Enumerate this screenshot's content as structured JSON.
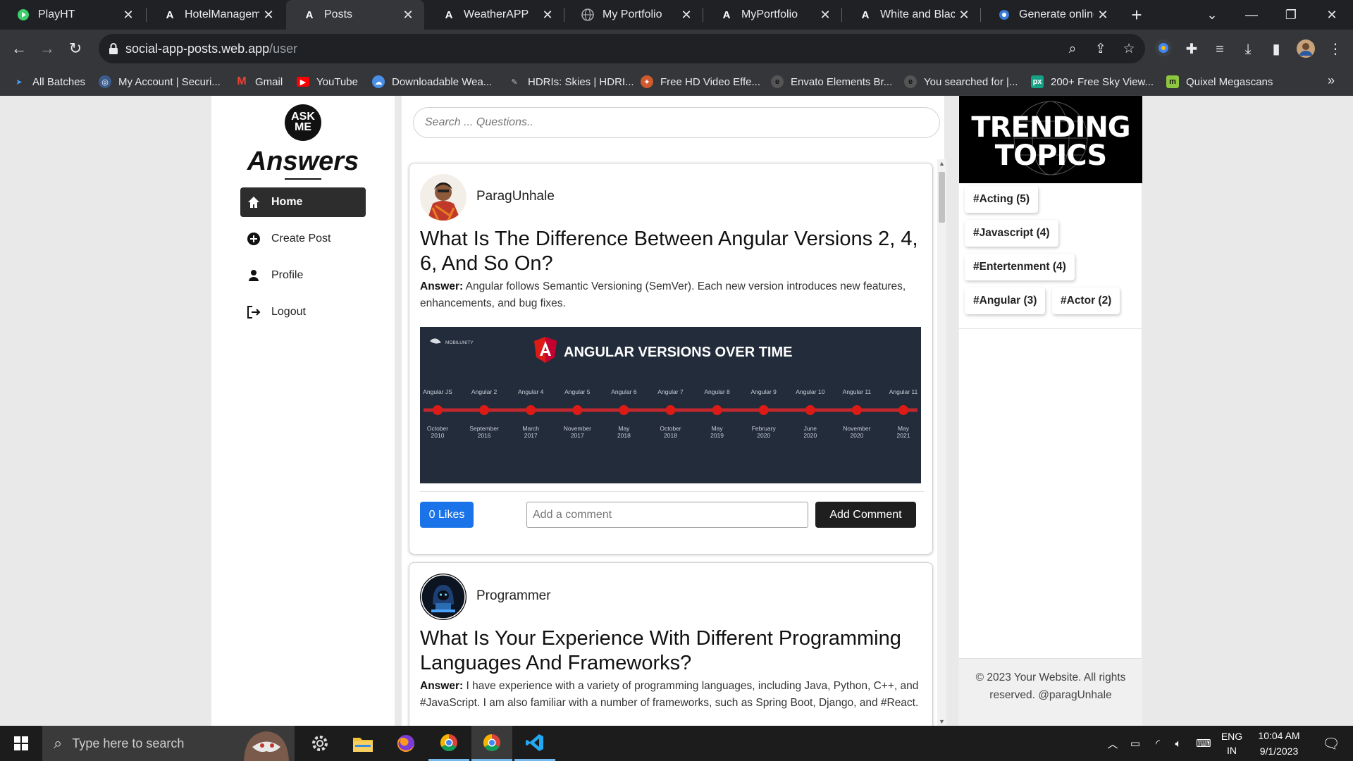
{
  "browser": {
    "tabs": [
      {
        "title": "PlayHT",
        "icon": "playht-icon"
      },
      {
        "title": "HotelManagemen",
        "icon": "angular-icon"
      },
      {
        "title": "Posts",
        "icon": "angular-icon",
        "active": true
      },
      {
        "title": "WeatherAPP",
        "icon": "angular-icon"
      },
      {
        "title": "My Portfolio",
        "icon": "globe-icon"
      },
      {
        "title": "MyPortfolio",
        "icon": "angular-icon"
      },
      {
        "title": "White and Black I",
        "icon": "angular-icon"
      },
      {
        "title": "Generate online A",
        "icon": "gear-icon"
      }
    ],
    "url_host": "social-app-posts.web.app",
    "url_path": "/user",
    "bookmarks": [
      {
        "label": "All Batches",
        "icon": "pin-icon"
      },
      {
        "label": "My Account | Securi...",
        "icon": "shield-icon"
      },
      {
        "label": "Gmail",
        "icon": "gmail-icon"
      },
      {
        "label": "YouTube",
        "icon": "youtube-icon"
      },
      {
        "label": "Downloadable Wea...",
        "icon": "globe-icon"
      },
      {
        "label": "HDRIs: Skies | HDRI...",
        "icon": "hdri-icon"
      },
      {
        "label": "Free HD Video Effe...",
        "icon": "video-icon"
      },
      {
        "label": "Envato Elements Br...",
        "icon": "envato-icon"
      },
      {
        "label": "You searched for |...",
        "icon": "envato-icon"
      },
      {
        "label": "200+ Free Sky View...",
        "icon": "px-icon"
      },
      {
        "label": "Quixel Megascans",
        "icon": "quixel-icon"
      }
    ],
    "bookmarks_more": "»"
  },
  "sidebar": {
    "logo_text": "ASK ME",
    "brand": "Answers",
    "items": [
      {
        "label": "Home",
        "icon": "home-icon",
        "active": true
      },
      {
        "label": "Create Post",
        "icon": "plus-circle-icon"
      },
      {
        "label": "Profile",
        "icon": "person-icon"
      },
      {
        "label": "Logout",
        "icon": "logout-icon"
      }
    ]
  },
  "search": {
    "placeholder": "Search ... Questions.."
  },
  "posts": [
    {
      "author": "ParagUnhale",
      "title": "What Is The Difference Between Angular Versions 2, 4, 6, And So On?",
      "answer_label": "Answer:",
      "answer": " Angular follows Semantic Versioning (SemVer). Each new version introduces new features, enhancements, and bug fixes.",
      "image": {
        "brand": "MOBILUNITY",
        "heading": "ANGULAR VERSIONS OVER TIME",
        "timeline": [
          {
            "version": "Angular JS",
            "date1": "October",
            "date2": "2010"
          },
          {
            "version": "Angular 2",
            "date1": "September",
            "date2": "2016"
          },
          {
            "version": "Angular 4",
            "date1": "March",
            "date2": "2017"
          },
          {
            "version": "Angular 5",
            "date1": "November",
            "date2": "2017"
          },
          {
            "version": "Angular 6",
            "date1": "May",
            "date2": "2018"
          },
          {
            "version": "Angular 7",
            "date1": "October",
            "date2": "2018"
          },
          {
            "version": "Angular 8",
            "date1": "May",
            "date2": "2019"
          },
          {
            "version": "Angular 9",
            "date1": "February",
            "date2": "2020"
          },
          {
            "version": "Angular 10",
            "date1": "June",
            "date2": "2020"
          },
          {
            "version": "Angular 11",
            "date1": "November",
            "date2": "2020"
          },
          {
            "version": "Angular 11",
            "date1": "May",
            "date2": "2021"
          }
        ]
      },
      "likes_label": "0 Likes",
      "comment_placeholder": "Add a comment",
      "comment_button": "Add Comment"
    },
    {
      "author": "Programmer",
      "title": "What Is Your Experience With Different Programming Languages And Frameworks?",
      "answer_label": "Answer:",
      "answer": " I have experience with a variety of programming languages, including Java, Python, C++, and #JavaScript. I am also familiar with a number of frameworks, such as Spring Boot, Django, and #React."
    }
  ],
  "trending": {
    "line1": "TRENDING",
    "line2": "TOPICS",
    "tags": [
      "#Acting (5)",
      "#Javascript (4)",
      "#Entertenment (4)",
      "#Angular (3)",
      "#Actor (2)"
    ]
  },
  "footer": {
    "text": "© 2023 Your Website. All rights reserved. @paragUnhale"
  },
  "taskbar": {
    "search_placeholder": "Type here to search",
    "language": "ENG",
    "region": "IN",
    "time": "10:04 AM",
    "date": "9/1/2023"
  },
  "colors": {
    "accent_blue": "#1a73e8",
    "dark_button": "#1f1f1f",
    "angular_red": "#dd1b16",
    "chrome_dark": "#202124"
  }
}
